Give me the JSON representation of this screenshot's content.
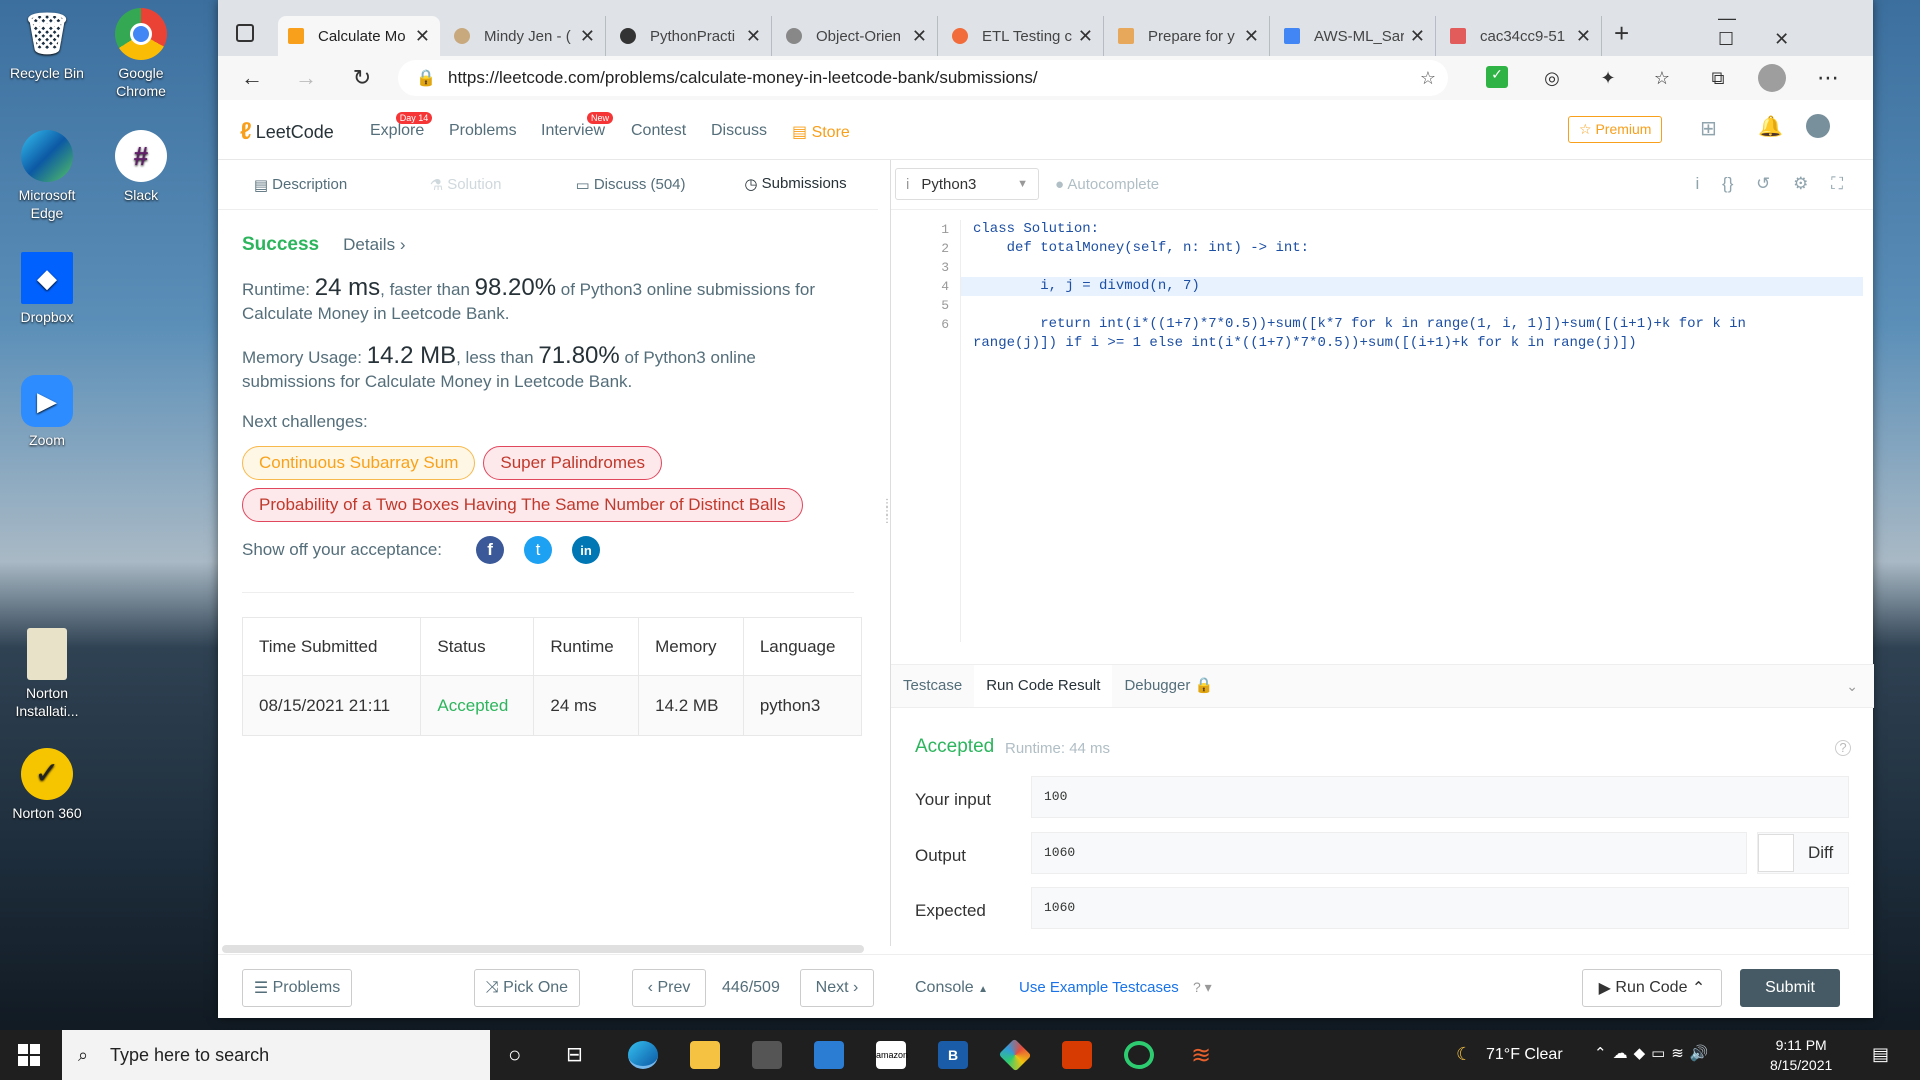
{
  "desktop": {
    "icons": [
      "Recycle Bin",
      "Google Chrome",
      "Microsoft Edge",
      "Slack",
      "Dropbox",
      "Zoom",
      "Norton Installati...",
      "Norton 360"
    ]
  },
  "browser": {
    "tabs": [
      "Calculate Mo",
      "Mindy Jen - (",
      "PythonPracti",
      "Object-Orien",
      "ETL Testing c",
      "Prepare for y",
      "AWS-ML_Sar",
      "cac34cc9-51"
    ],
    "url": "https://leetcode.com/problems/calculate-money-in-leetcode-bank/submissions/"
  },
  "lc_nav": {
    "logo": "LeetCode",
    "explore": "Explore",
    "explore_badge": "Day 14",
    "problems": "Problems",
    "interview": "Interview",
    "interview_badge": "New",
    "contest": "Contest",
    "discuss": "Discuss",
    "store": "Store",
    "premium": "Premium"
  },
  "left_tabs": [
    "Description",
    "Solution",
    "Discuss (504)",
    "Submissions"
  ],
  "result": {
    "status": "Success",
    "details": "Details",
    "runtime_label": "Runtime:",
    "runtime": "24 ms",
    "runtime_mid": ", faster than",
    "runtime_pct": "98.20%",
    "runtime_tail": "of Python3 online submissions for Calculate Money in Leetcode Bank.",
    "memory_label": "Memory Usage:",
    "memory": "14.2 MB",
    "memory_mid": ", less than",
    "memory_pct": "71.80%",
    "memory_tail": "of Python3 online submissions for Calculate Money in Leetcode Bank.",
    "next_label": "Next challenges:",
    "challenges": [
      "Continuous Subarray Sum",
      "Super Palindromes",
      "Probability of a Two Boxes Having The Same Number of Distinct Balls"
    ],
    "show_off": "Show off your acceptance:"
  },
  "table": {
    "headers": [
      "Time Submitted",
      "Status",
      "Runtime",
      "Memory",
      "Language"
    ],
    "row": [
      "08/15/2021 21:11",
      "Accepted",
      "24 ms",
      "14.2 MB",
      "python3"
    ]
  },
  "bottom_left": {
    "problems": "Problems",
    "pick": "Pick One",
    "prev": "Prev",
    "page": "446/509",
    "next": "Next"
  },
  "editor": {
    "language": "Python3",
    "autocomplete": "Autocomplete",
    "lines": [
      "1",
      "2",
      "3",
      "4",
      "5",
      "6"
    ],
    "code": [
      "class Solution:",
      "    def totalMoney(self, n: int) -> int:",
      "",
      "        i, j = divmod(n, 7)",
      "",
      "        return int(i*((1+7)*7*0.5))+sum([k*7 for k in range(1, i, 1)])+sum([(i+1)+k for k in",
      "range(j)]) if i >= 1 else int(i*((1+7)*7*0.5))+sum([(i+1)+k for k in range(j)])"
    ]
  },
  "console": {
    "tabs": [
      "Testcase",
      "Run Code Result",
      "Debugger"
    ],
    "accepted": "Accepted",
    "runtime": "Runtime: 44 ms",
    "input_label": "Your input",
    "input": "100",
    "output_label": "Output",
    "output": "1060",
    "diff": "Diff",
    "expected_label": "Expected",
    "expected": "1060",
    "console_btn": "Console",
    "example": "Use Example Testcases",
    "run": "Run Code",
    "submit": "Submit"
  },
  "taskbar": {
    "search": "Type here to search",
    "weather": "71°F  Clear",
    "time": "9:11 PM",
    "date": "8/15/2021"
  }
}
